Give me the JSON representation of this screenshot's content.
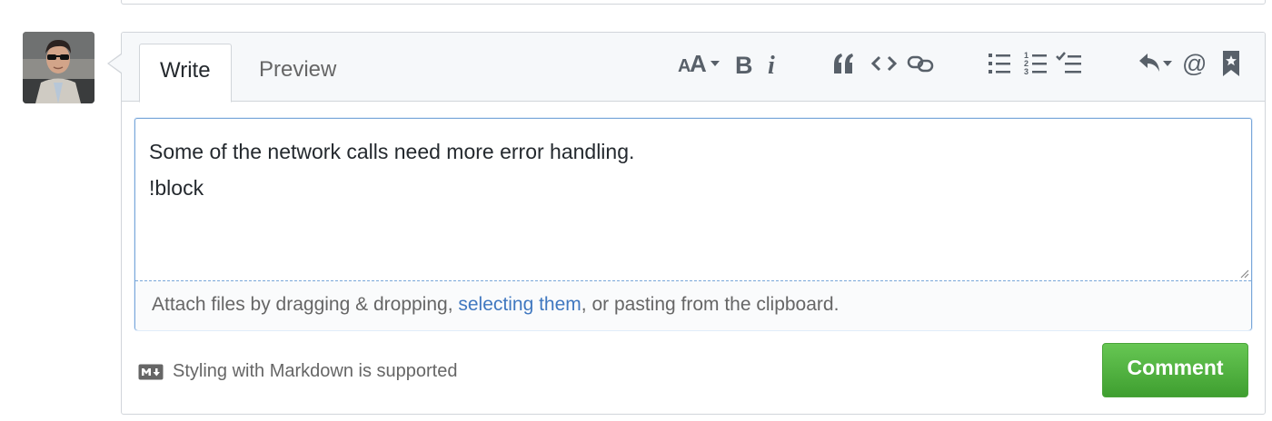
{
  "tabs": {
    "write": "Write",
    "preview": "Preview"
  },
  "toolbar": [
    {
      "name": "header-text-icon"
    },
    {
      "name": "bold-icon"
    },
    {
      "name": "italic-icon"
    },
    {
      "name": "quote-icon"
    },
    {
      "name": "code-icon"
    },
    {
      "name": "link-icon"
    },
    {
      "name": "unordered-list-icon"
    },
    {
      "name": "ordered-list-icon"
    },
    {
      "name": "task-list-icon"
    },
    {
      "name": "reply-icon"
    },
    {
      "name": "mention-icon"
    },
    {
      "name": "saved-reply-icon"
    }
  ],
  "editor": {
    "text": "Some of the network calls need more error handling.\n!block"
  },
  "attach": {
    "prefix": "Attach files by dragging & dropping, ",
    "link": "selecting them",
    "suffix": ", or pasting from the clipboard."
  },
  "markdown_hint": "Styling with Markdown is supported",
  "comment_button": "Comment",
  "colors": {
    "accent_green": "#4aa43a",
    "link_blue": "#4078c0",
    "focus_border": "#7aa7d9"
  }
}
